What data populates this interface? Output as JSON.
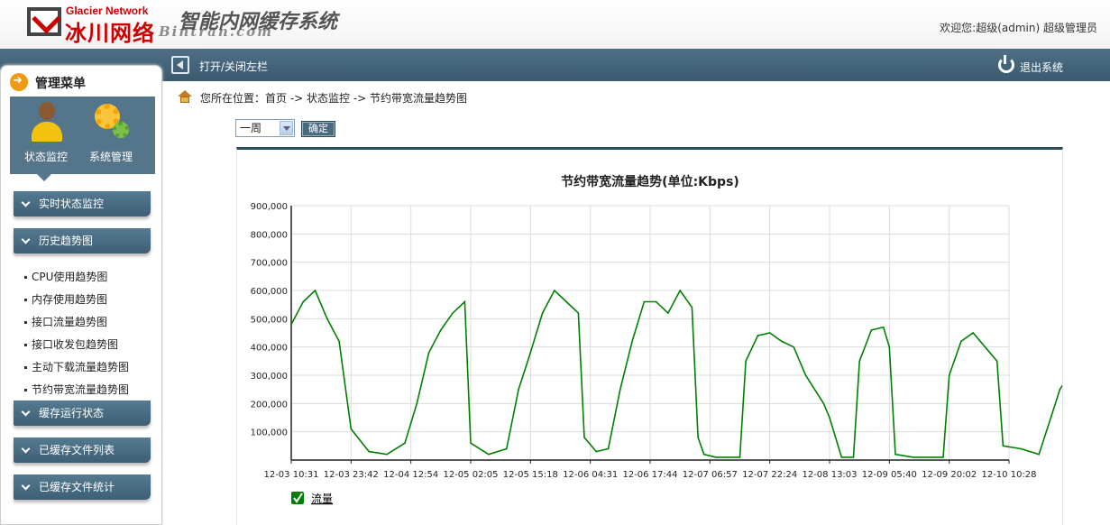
{
  "header": {
    "brand_en": "Glacier Network",
    "brand_cn": "冰川网络",
    "system_name": "智能内网缓存系统",
    "watermark": "Bintran.com",
    "welcome": "欢迎您:超级(admin) 超级管理员"
  },
  "topbar": {
    "toggle_label": "打开/关闭左栏",
    "logout_label": "退出系统"
  },
  "sidebar": {
    "menu_title": "管理菜单",
    "categories": [
      {
        "label": "状态监控",
        "icon": "user-icon"
      },
      {
        "label": "系统管理",
        "icon": "gears-icon"
      }
    ],
    "nav": [
      {
        "label": "实时状态监控"
      },
      {
        "label": "历史趋势图"
      },
      {
        "label": "缓存运行状态"
      },
      {
        "label": "已缓存文件列表"
      },
      {
        "label": "已缓存文件统计"
      }
    ],
    "sub_items": [
      {
        "label": "CPU使用趋势图"
      },
      {
        "label": "内存使用趋势图"
      },
      {
        "label": "接口流量趋势图"
      },
      {
        "label": "接口收发包趋势图"
      },
      {
        "label": "主动下载流量趋势图"
      },
      {
        "label": "节约带宽流量趋势图"
      }
    ]
  },
  "breadcrumb": "您所在位置：首页 -> 状态监控 -> 节约带宽流量趋势图",
  "controls": {
    "period_selected": "一周",
    "ok_label": "确定"
  },
  "colors": {
    "accent": "#3b5a70",
    "brand_red": "#cc0000",
    "series": "#008000"
  },
  "chart_data": {
    "type": "line",
    "title": "节约带宽流量趋势(单位:Kbps)",
    "y_ticks": [
      "100,000",
      "200,000",
      "300,000",
      "400,000",
      "500,000",
      "600,000",
      "700,000",
      "800,000",
      "900,000"
    ],
    "ylim": [
      0,
      900000
    ],
    "x_ticks": [
      "12-03 10:31",
      "12-03 23:42",
      "12-04 12:54",
      "12-05 02:05",
      "12-05 15:18",
      "12-06 04:31",
      "12-06 17:44",
      "12-07 06:57",
      "12-07 22:24",
      "12-08 13:03",
      "12-09 05:40",
      "12-09 20:02",
      "12-10 10:28"
    ],
    "grid": true,
    "legend_position": "bottom-left",
    "series": [
      {
        "name": "流量",
        "color": "#008000",
        "points": [
          [
            0.0,
            480000
          ],
          [
            0.2,
            560000
          ],
          [
            0.4,
            600000
          ],
          [
            0.6,
            500000
          ],
          [
            0.8,
            420000
          ],
          [
            1.0,
            110000
          ],
          [
            1.3,
            30000
          ],
          [
            1.6,
            20000
          ],
          [
            1.9,
            60000
          ],
          [
            2.1,
            200000
          ],
          [
            2.3,
            380000
          ],
          [
            2.5,
            460000
          ],
          [
            2.7,
            520000
          ],
          [
            2.9,
            560000
          ],
          [
            3.0,
            60000
          ],
          [
            3.3,
            20000
          ],
          [
            3.6,
            40000
          ],
          [
            3.8,
            250000
          ],
          [
            4.0,
            380000
          ],
          [
            4.2,
            520000
          ],
          [
            4.4,
            600000
          ],
          [
            4.6,
            560000
          ],
          [
            4.8,
            520000
          ],
          [
            4.9,
            80000
          ],
          [
            5.1,
            30000
          ],
          [
            5.3,
            40000
          ],
          [
            5.5,
            250000
          ],
          [
            5.7,
            420000
          ],
          [
            5.9,
            560000
          ],
          [
            6.1,
            560000
          ],
          [
            6.3,
            520000
          ],
          [
            6.5,
            600000
          ],
          [
            6.7,
            540000
          ],
          [
            6.8,
            80000
          ],
          [
            6.9,
            20000
          ],
          [
            7.1,
            10000
          ],
          [
            7.3,
            10000
          ],
          [
            7.5,
            10000
          ],
          [
            7.6,
            350000
          ],
          [
            7.8,
            440000
          ],
          [
            8.0,
            450000
          ],
          [
            8.2,
            420000
          ],
          [
            8.4,
            400000
          ],
          [
            8.6,
            300000
          ],
          [
            8.9,
            200000
          ],
          [
            9.0,
            150000
          ],
          [
            9.2,
            10000
          ],
          [
            9.4,
            10000
          ],
          [
            9.5,
            350000
          ],
          [
            9.7,
            460000
          ],
          [
            9.9,
            470000
          ],
          [
            10.0,
            400000
          ],
          [
            10.1,
            20000
          ],
          [
            10.4,
            10000
          ],
          [
            10.7,
            10000
          ],
          [
            10.9,
            10000
          ],
          [
            11.0,
            300000
          ],
          [
            11.2,
            420000
          ],
          [
            11.4,
            450000
          ],
          [
            11.6,
            400000
          ],
          [
            11.8,
            350000
          ],
          [
            11.9,
            50000
          ],
          [
            12.2,
            40000
          ],
          [
            12.5,
            20000
          ],
          [
            12.7,
            150000
          ],
          [
            12.85,
            250000
          ],
          [
            13.0,
            300000
          ]
        ]
      }
    ]
  }
}
